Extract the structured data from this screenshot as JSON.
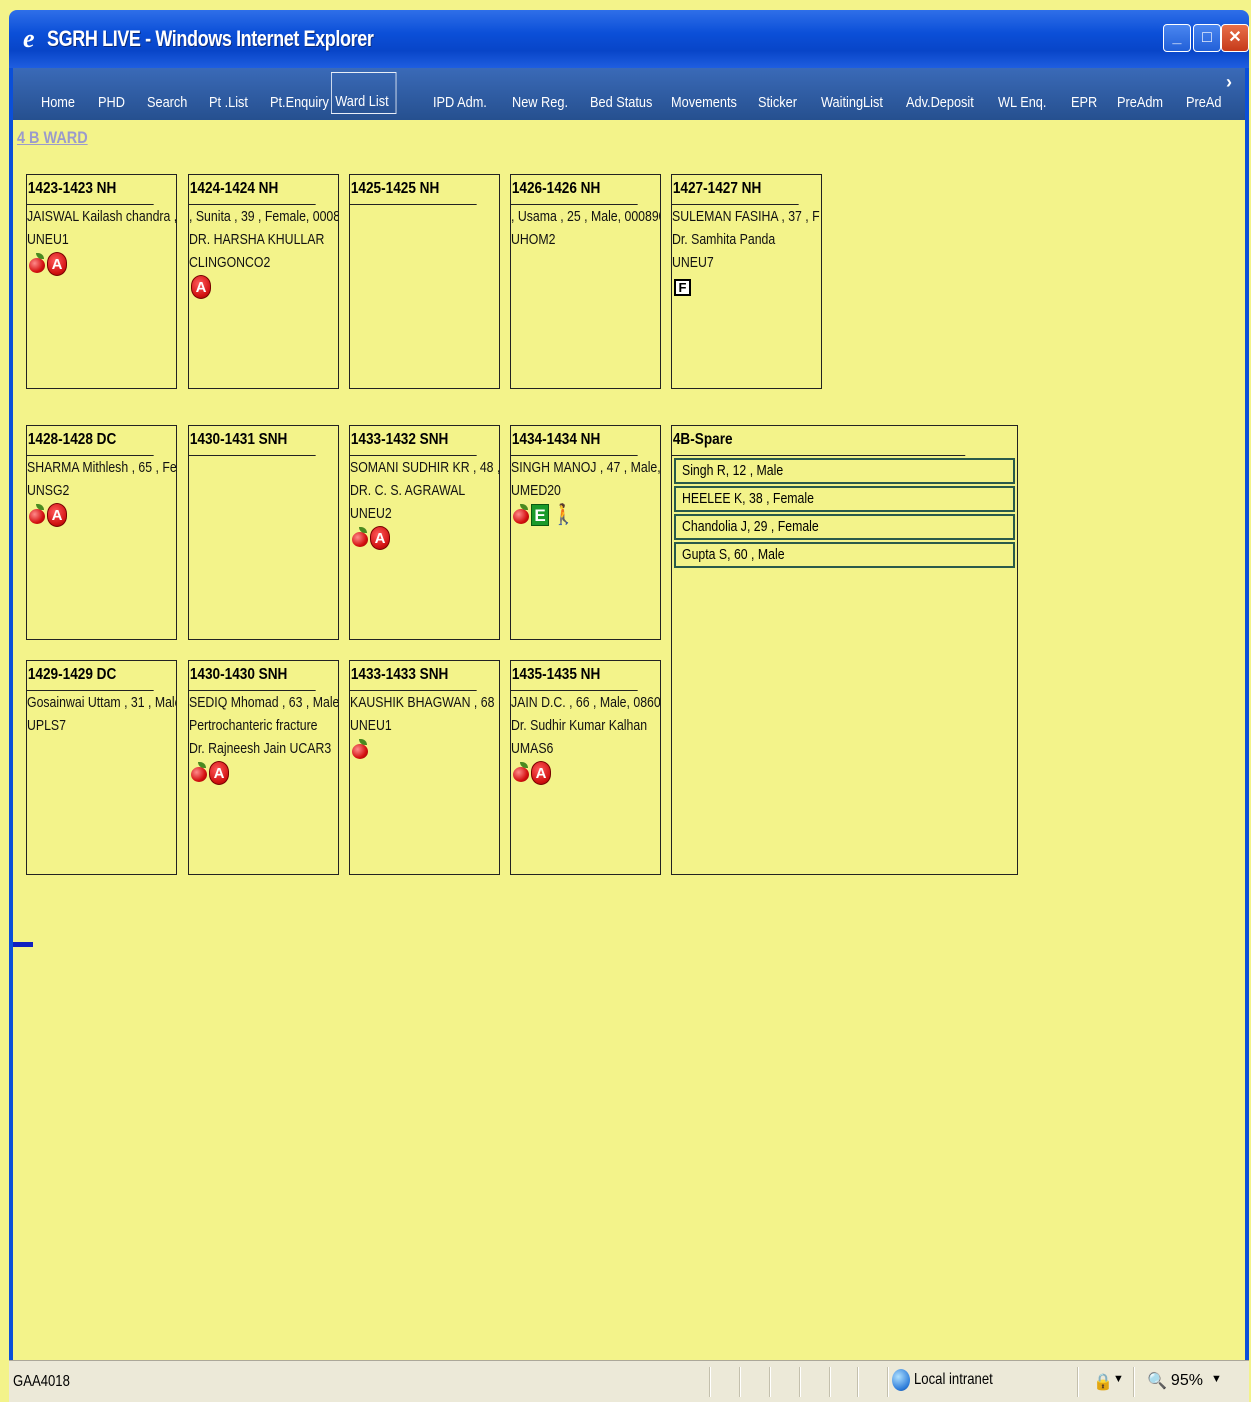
{
  "window": {
    "title": "SGRH LIVE - Windows Internet Explorer"
  },
  "menu": [
    {
      "label": "Home",
      "active": false
    },
    {
      "label": "PHD",
      "active": false
    },
    {
      "label": "Search",
      "active": false
    },
    {
      "label": "Pt .List",
      "active": false
    },
    {
      "label": "Pt.Enquiry",
      "active": false
    },
    {
      "label": "Ward List",
      "active": true
    },
    {
      "label": "IPD Adm.",
      "active": false
    },
    {
      "label": "New Reg.",
      "active": false
    },
    {
      "label": "Bed Status",
      "active": false
    },
    {
      "label": "Movements",
      "active": false
    },
    {
      "label": "Sticker",
      "active": false
    },
    {
      "label": "WaitingList",
      "active": false
    },
    {
      "label": "Adv.Deposit",
      "active": false
    },
    {
      "label": "WL Enq.",
      "active": false
    },
    {
      "label": "EPR",
      "active": false
    },
    {
      "label": "PreAdm",
      "active": false
    },
    {
      "label": "PreAd",
      "active": false
    }
  ],
  "ward": {
    "name": "4 B WARD"
  },
  "beds": [
    {
      "title": "1423-1423 NH",
      "lines": [
        "JAISWAL Kailash chandra ,",
        "UNEU1"
      ],
      "icons": [
        "apple-icon",
        "alert-a-icon"
      ]
    },
    {
      "title": "1424-1424 NH",
      "lines": [
        ", Sunita , 39 , Female, 0008",
        "DR. HARSHA KHULLAR",
        "CLINGONCO2"
      ],
      "icons": [
        "alert-a-icon"
      ]
    },
    {
      "title": "1425-1425 NH",
      "lines": [],
      "icons": []
    },
    {
      "title": "1426-1426 NH",
      "lines": [
        ", Usama , 25 , Male, 000890",
        "UHOM2"
      ],
      "icons": []
    },
    {
      "title": "1427-1427 NH",
      "lines": [
        "SULEMAN FASIHA , 37 , F",
        "Dr. Samhita Panda",
        "UNEU7"
      ],
      "icons": [
        "f-flag-icon"
      ]
    },
    {
      "title": "1428-1428 DC",
      "lines": [
        "SHARMA Mithlesh , 65 , Fe",
        "UNSG2"
      ],
      "icons": [
        "apple-icon",
        "alert-a-icon"
      ]
    },
    {
      "title": "1430-1431 SNH",
      "lines": [],
      "icons": []
    },
    {
      "title": "1433-1432 SNH",
      "lines": [
        "SOMANI SUDHIR KR , 48 ,",
        "DR. C. S. AGRAWAL",
        "UNEU2"
      ],
      "icons": [
        "apple-icon",
        "alert-a-icon"
      ]
    },
    {
      "title": "1434-1434 NH",
      "lines": [
        "SINGH MANOJ , 47 , Male,",
        "UMED20"
      ],
      "icons": [
        "apple-icon",
        "e-flag-icon",
        "person-icon"
      ]
    },
    {
      "title": "1429-1429 DC",
      "lines": [
        "Gosainwai Uttam , 31 , Male",
        "UPLS7"
      ],
      "icons": []
    },
    {
      "title": "1430-1430 SNH",
      "lines": [
        "SEDIQ Mhomad , 63 , Male",
        "Pertrochanteric fracture",
        "Dr. Rajneesh Jain  UCAR3"
      ],
      "icons": [
        "apple-icon",
        "alert-a-icon"
      ]
    },
    {
      "title": "1433-1433 SNH",
      "lines": [
        "KAUSHIK BHAGWAN , 68 ,",
        "UNEU1"
      ],
      "icons": [
        "apple-icon"
      ]
    },
    {
      "title": "1435-1435 NH",
      "lines": [
        "JAIN D.C. , 66 , Male, 0860",
        "Dr. Sudhir Kumar Kalhan",
        "UMAS6"
      ],
      "icons": [
        "apple-icon",
        "alert-a-icon"
      ]
    }
  ],
  "spare": {
    "title": "4B-Spare",
    "patients": [
      "Singh R, 12 , Male",
      "HEELEE K, 38 , Female",
      "Chandolia J, 29 , Female",
      "Gupta S, 60 , Male"
    ]
  },
  "status": {
    "text": "GAA4018",
    "zone": "Local intranet",
    "zoom": "95%"
  }
}
